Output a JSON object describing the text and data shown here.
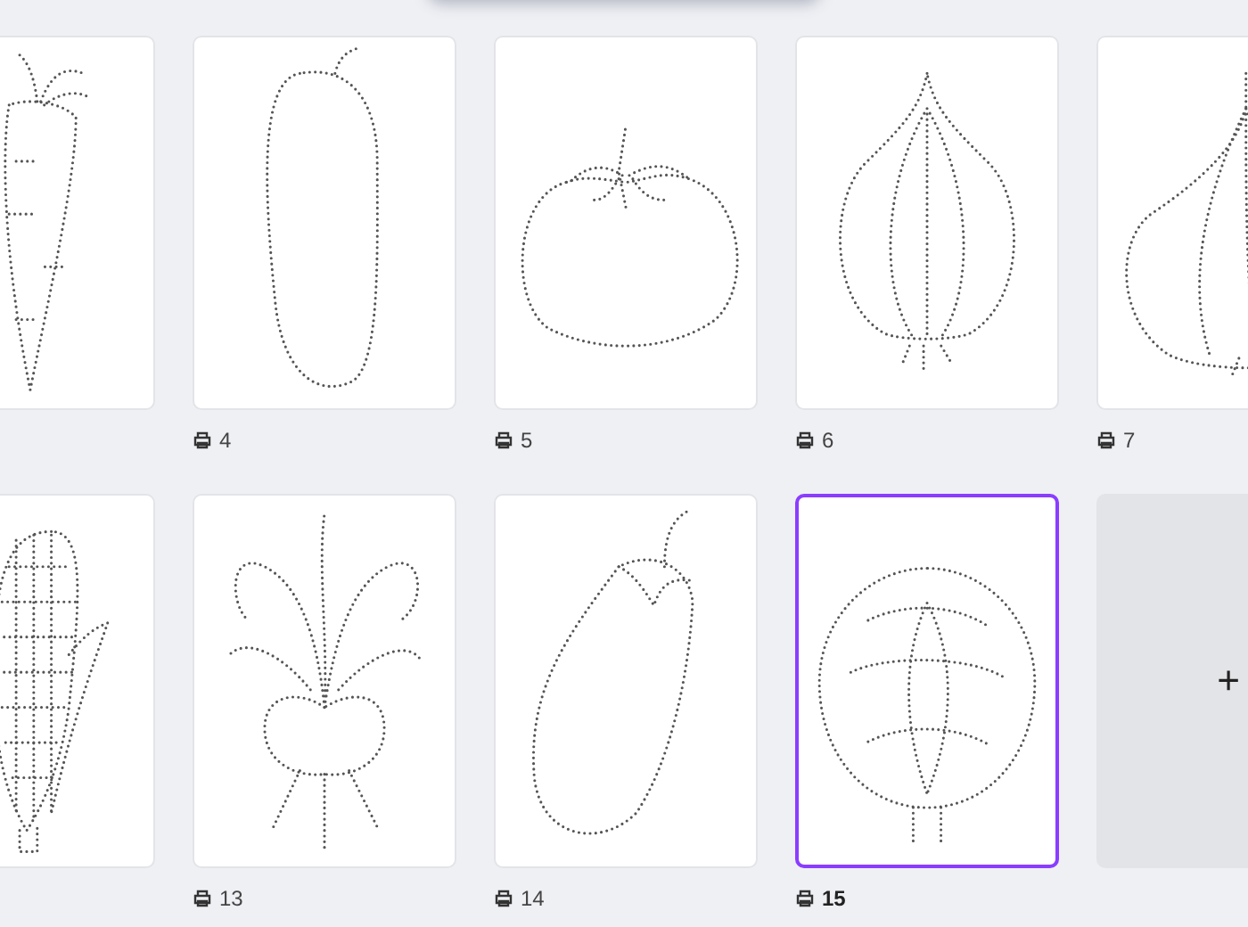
{
  "rows": [
    {
      "pages": [
        {
          "kind": "carrot",
          "selected": false
        },
        {
          "kind": "cucumber",
          "label": "4",
          "selected": false
        },
        {
          "kind": "tomato",
          "label": "5",
          "selected": false
        },
        {
          "kind": "onion",
          "label": "6",
          "selected": false
        },
        {
          "kind": "garlic",
          "label": "7",
          "selected": false
        }
      ]
    },
    {
      "pages": [
        {
          "kind": "corn",
          "selected": false
        },
        {
          "kind": "radish",
          "label": "13",
          "selected": false
        },
        {
          "kind": "eggplant",
          "label": "14",
          "selected": false
        },
        {
          "kind": "cabbage",
          "label": "15",
          "selected": true
        },
        {
          "kind": "add",
          "label": "+"
        }
      ]
    }
  ]
}
